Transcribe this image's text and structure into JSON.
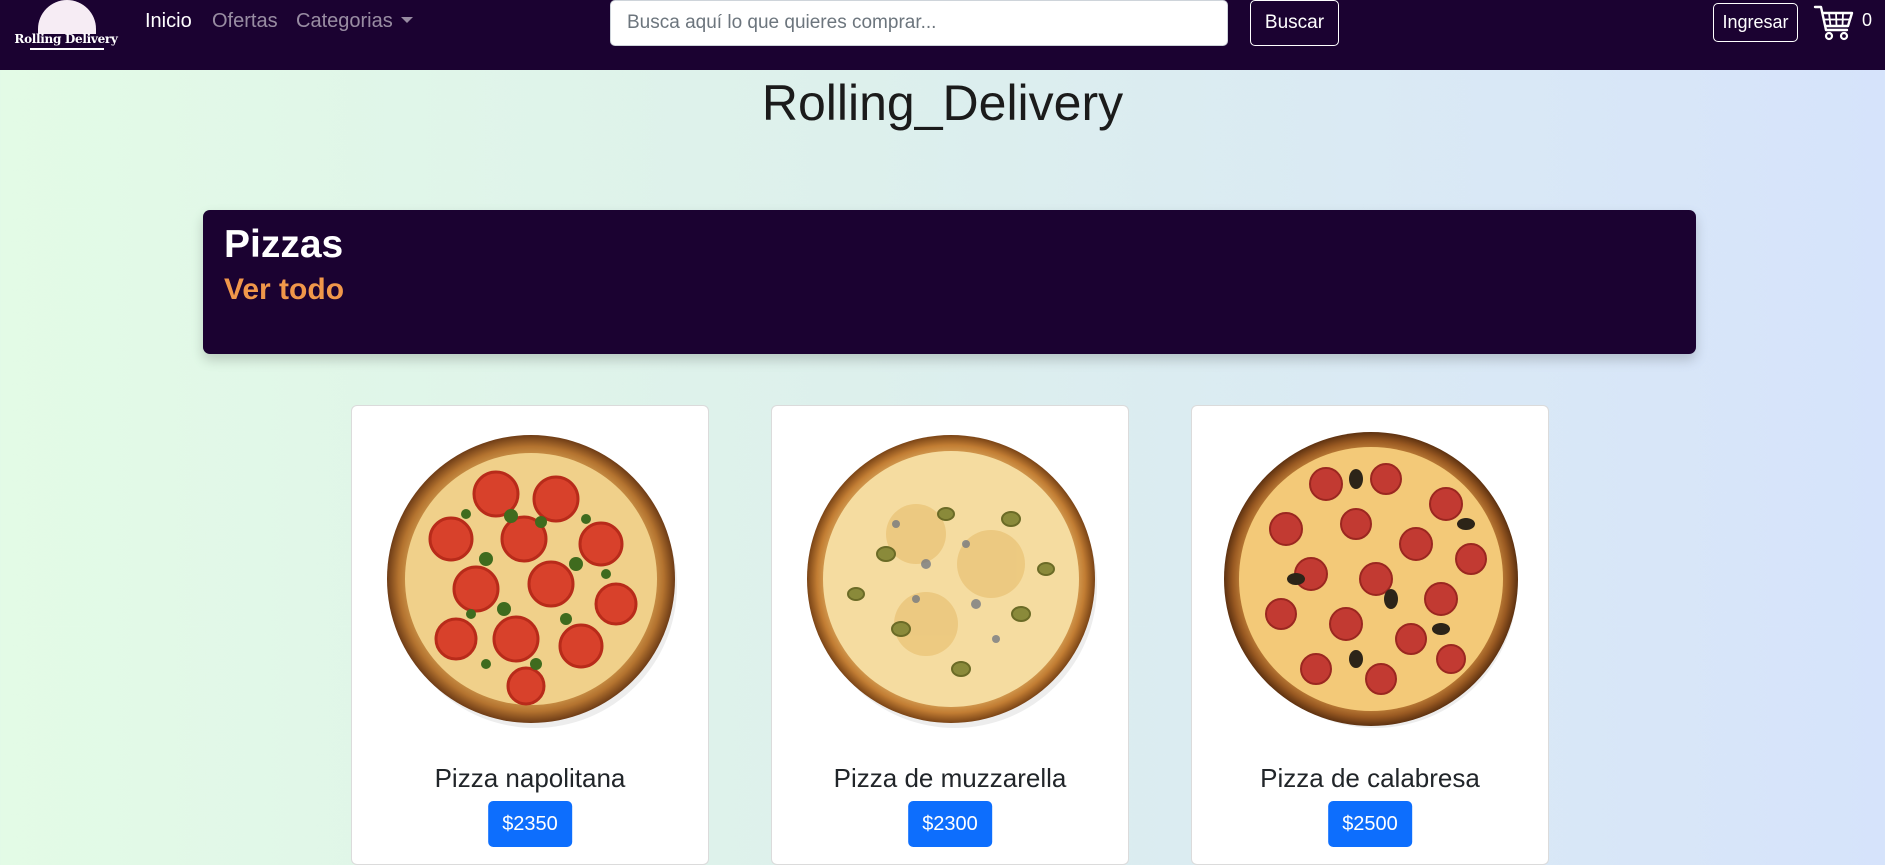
{
  "nav": {
    "logo_text": "Rolling Delivery",
    "links": [
      {
        "label": "Inicio",
        "active": true
      },
      {
        "label": "Ofertas",
        "active": false
      },
      {
        "label": "Categorias",
        "active": false
      }
    ],
    "search_placeholder": "Busca aquí lo que quieres comprar...",
    "search_button": "Buscar",
    "login_button": "Ingresar",
    "cart_icon": "shopping-cart-icon",
    "cart_count": "0"
  },
  "page": {
    "title": "Rolling_Delivery"
  },
  "section": {
    "title": "Pizzas",
    "view_all": "Ver todo"
  },
  "products": [
    {
      "name": "Pizza napolitana",
      "price": "$2350",
      "image": "pizza-napolitana-image"
    },
    {
      "name": "Pizza de muzzarella",
      "price": "$2300",
      "image": "pizza-muzzarella-image"
    },
    {
      "name": "Pizza de calabresa",
      "price": "$2500",
      "image": "pizza-calabresa-image"
    }
  ],
  "colors": {
    "navbar": "#1b0231",
    "accent_orange": "#f0974a",
    "price_button": "#0d6efd"
  }
}
